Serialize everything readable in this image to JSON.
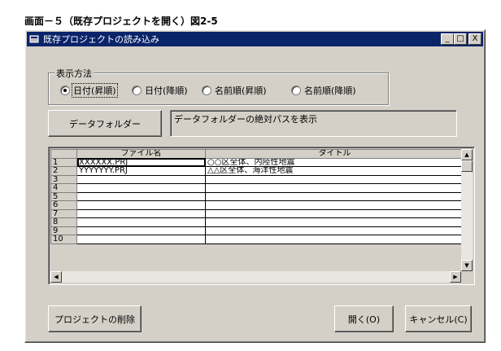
{
  "caption": "画面－５（既存プロジェクトを開く）図2-5",
  "window": {
    "title": "既存プロジェクトの読み込み",
    "minimize": "_",
    "maximize": "□",
    "close": "X"
  },
  "display_method": {
    "label": "表示方法",
    "options": [
      {
        "label": "日付(昇順)",
        "checked": true
      },
      {
        "label": "日付(降順)",
        "checked": false
      },
      {
        "label": "名前順(昇順)",
        "checked": false
      },
      {
        "label": "名前順(降順)",
        "checked": false
      }
    ]
  },
  "data_folder": {
    "button_label": "データフォルダー",
    "path_text": "データフォルダーの絶対パスを表示"
  },
  "grid": {
    "columns": [
      "ファイル名",
      "タイトル"
    ],
    "rows": [
      {
        "num": "1",
        "file": "XXXXXX.PRJ",
        "title": "○○区全体、内陸性地震"
      },
      {
        "num": "2",
        "file": "YYYYYYY.PRJ",
        "title": "△△区全体、海洋性地震"
      },
      {
        "num": "3",
        "file": "",
        "title": ""
      },
      {
        "num": "4",
        "file": "",
        "title": ""
      },
      {
        "num": "5",
        "file": "",
        "title": ""
      },
      {
        "num": "6",
        "file": "",
        "title": ""
      },
      {
        "num": "7",
        "file": "",
        "title": ""
      },
      {
        "num": "8",
        "file": "",
        "title": ""
      },
      {
        "num": "9",
        "file": "",
        "title": ""
      },
      {
        "num": "10",
        "file": "",
        "title": ""
      }
    ]
  },
  "buttons": {
    "delete": "プロジェクトの削除",
    "open": "開く(O)",
    "cancel": "キャンセル(C)"
  }
}
